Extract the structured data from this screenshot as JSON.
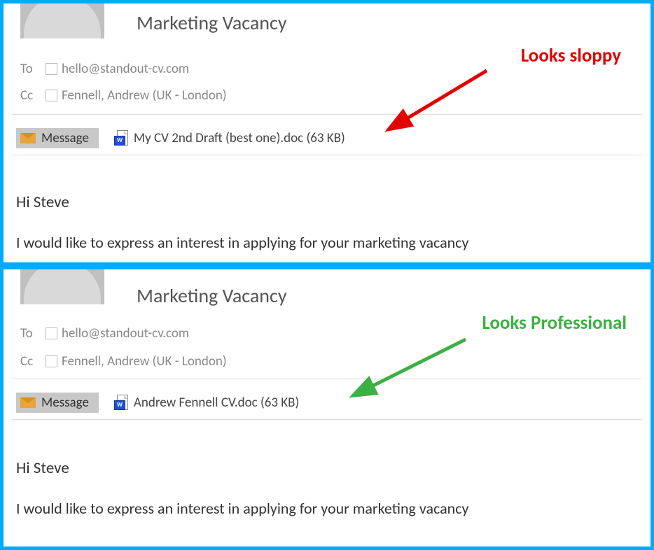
{
  "top_email": {
    "subject": "Marketing Vacancy",
    "to_label": "To",
    "to_value": "hello@standout-cv.com",
    "cc_label": "Cc",
    "cc_value": "Fennell, Andrew (UK - London)",
    "message_tab": "Message",
    "attachment_name": "My CV 2nd Draft (best one).doc (63 KB)",
    "greeting": "Hi Steve",
    "body_line": "I would like to express an interest in applying for your marketing vacancy",
    "annotation": "Looks sloppy"
  },
  "bottom_email": {
    "subject": "Marketing Vacancy",
    "to_label": "To",
    "to_value": "hello@standout-cv.com",
    "cc_label": "Cc",
    "cc_value": "Fennell, Andrew (UK - London)",
    "message_tab": "Message",
    "attachment_name": "Andrew Fennell CV.doc (63 KB)",
    "greeting": "Hi Steve",
    "body_line": "I would like to express an interest in applying for your marketing vacancy",
    "annotation": "Looks Professional"
  }
}
